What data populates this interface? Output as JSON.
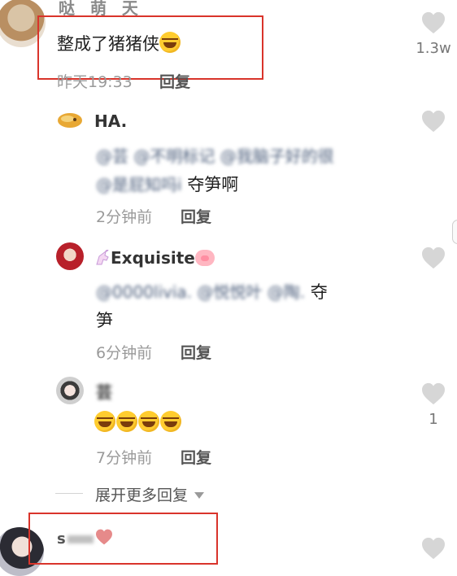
{
  "comments": [
    {
      "name_partial": "哒 萌 天",
      "text": "整成了猪猪侠",
      "time": "昨天19:33",
      "reply": "回复",
      "likes": "1.3w"
    },
    {
      "name": "HA.",
      "mention_line1": "@芸 @不明标记 @我脑子好的很",
      "mention_line2_prefix": "@是屁知吗i",
      "text_suffix": "夺笋啊",
      "time": "2分钟前",
      "reply": "回复"
    },
    {
      "name": "Exquisite",
      "mention_line1": "@0000livia. @悦悦叶 @陶.",
      "text_line1_suffix": "夺",
      "text_line2": "笋",
      "time": "6分钟前",
      "reply": "回复"
    },
    {
      "name": "芸",
      "time": "7分钟前",
      "reply": "回复",
      "likes": "1"
    }
  ],
  "expand_more": "展开更多回复",
  "bottom_comment": {
    "name_partial": "s"
  }
}
